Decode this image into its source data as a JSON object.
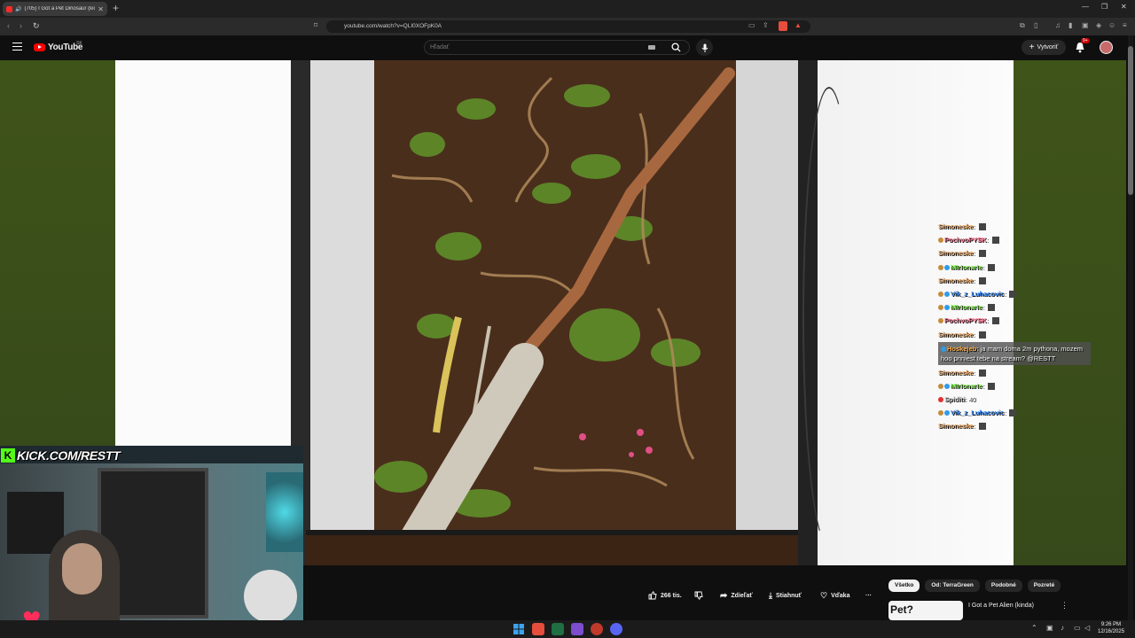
{
  "browser": {
    "tab_title": "(705) I Got a Pet Dinosaur (kick",
    "url": "youtube.com/watch?v=QLI0XOFpK0A"
  },
  "youtube": {
    "logo": "YouTube",
    "region": "SK",
    "search_placeholder": "Hľadať",
    "create_label": "Vytvoriť",
    "notif_badge": "9+"
  },
  "overlay": {
    "kick_label": "KICK.COM/RESTT"
  },
  "chat": [
    {
      "name": "Simoneske",
      "name_color": "#e8a15b",
      "text": "",
      "dots": []
    },
    {
      "name": "PochvoPYSK",
      "name_color": "#ff6b8a",
      "text": "",
      "dots": [
        "#c48b3a"
      ]
    },
    {
      "name": "Simoneske",
      "name_color": "#e8a15b",
      "text": "",
      "dots": []
    },
    {
      "name": "MIrIonarIe",
      "name_color": "#7bf542",
      "text": "",
      "dots": [
        "#c48b3a",
        "#2f9be8"
      ]
    },
    {
      "name": "Simoneske",
      "name_color": "#e8a15b",
      "text": "",
      "dots": []
    },
    {
      "name": "Vik_z_Luhacovic",
      "name_color": "#3a8dff",
      "text": "",
      "dots": [
        "#c48b3a",
        "#2f9be8"
      ]
    },
    {
      "name": "MIrIonarIe",
      "name_color": "#7bf542",
      "text": "",
      "dots": [
        "#c48b3a",
        "#2f9be8"
      ]
    },
    {
      "name": "PochvoPYSK",
      "name_color": "#ff6b8a",
      "text": "",
      "dots": [
        "#c48b3a"
      ]
    },
    {
      "name": "Simoneske",
      "name_color": "#e8a15b",
      "text": "",
      "dots": []
    },
    {
      "name": "Hoskejeb",
      "name_color": "#ffb14a",
      "text": "ja mam doma 2m pythona, mozem hoo priniest tebe na stream? @RESTT",
      "dots": [
        "#2f9be8"
      ],
      "highlight": true
    },
    {
      "name": "Simoneske",
      "name_color": "#e8a15b",
      "text": "",
      "dots": []
    },
    {
      "name": "MIrIonarIe",
      "name_color": "#7bf542",
      "text": "",
      "dots": [
        "#c48b3a",
        "#2f9be8"
      ]
    },
    {
      "name": "Spiditi",
      "name_color": "#c9c9c9",
      "text": "40",
      "dots": [
        "#e03030"
      ]
    },
    {
      "name": "Vik_z_Luhacovic",
      "name_color": "#3a8dff",
      "text": "",
      "dots": [
        "#c48b3a",
        "#2f9be8"
      ]
    },
    {
      "name": "Simoneske",
      "name_color": "#e8a15b",
      "text": "",
      "dots": []
    }
  ],
  "actions": {
    "likes": "266 tis.",
    "share": "Zdieľať",
    "download": "Stiahnuť",
    "thanks": "Vďaka",
    "more": "···"
  },
  "chips": [
    "Všetko",
    "Od: TerraGreen",
    "Podobné",
    "Pozreté"
  ],
  "recommended": {
    "thumb_text": "Pet?",
    "title": "I Got a Pet Alien (kinda)"
  },
  "taskbar": {
    "time": "9:26 PM",
    "date": "12/16/2025"
  }
}
